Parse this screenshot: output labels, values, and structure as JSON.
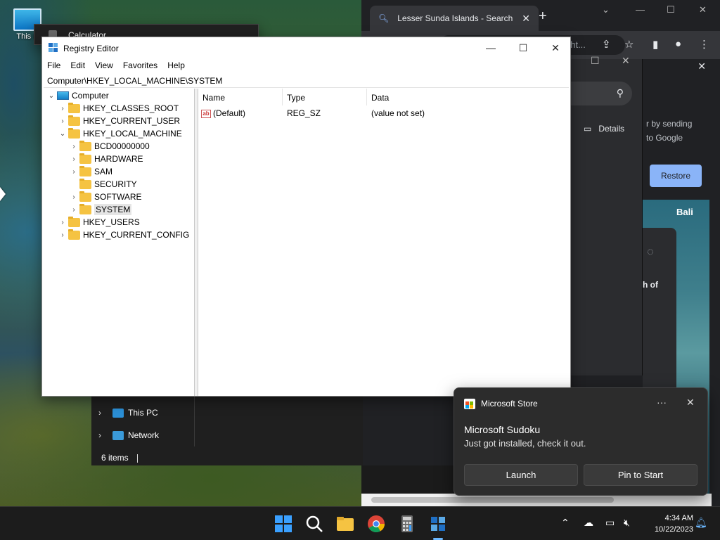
{
  "desktop": {
    "icon_label": "This P"
  },
  "calculator": {
    "title": "Calculator"
  },
  "chrome": {
    "tab_title": "Lesser Sunda Islands - Search",
    "omnibox_text": "ght...",
    "details_label": "Details",
    "partial_text_1": "r by sending",
    "partial_text_2": "to Google",
    "restore_label": "Restore",
    "bali_label": "Bali",
    "card_text": "h of"
  },
  "regedit": {
    "title": "Registry Editor",
    "menu": [
      "File",
      "Edit",
      "View",
      "Favorites",
      "Help"
    ],
    "address": "Computer\\HKEY_LOCAL_MACHINE\\SYSTEM",
    "tree": {
      "root": "Computer",
      "hkcr": "HKEY_CLASSES_ROOT",
      "hkcu": "HKEY_CURRENT_USER",
      "hklm": "HKEY_LOCAL_MACHINE",
      "bcd": "BCD00000000",
      "hardware": "HARDWARE",
      "sam": "SAM",
      "security": "SECURITY",
      "software": "SOFTWARE",
      "system": "SYSTEM",
      "hku": "HKEY_USERS",
      "hkcc": "HKEY_CURRENT_CONFIG"
    },
    "columns": {
      "name": "Name",
      "type": "Type",
      "data": "Data"
    },
    "values": [
      {
        "name": "(Default)",
        "type": "REG_SZ",
        "data": "(value not set)"
      }
    ]
  },
  "explorer": {
    "this_pc": "This PC",
    "network": "Network",
    "status": "6 items"
  },
  "notification": {
    "app": "Microsoft Store",
    "heading": "Microsoft Sudoku",
    "body": "Just got installed, check it out.",
    "launch_label": "Launch",
    "pin_label": "Pin to Start"
  },
  "taskbar": {
    "time": "4:34 AM",
    "date": "10/22/2023"
  },
  "colors": {
    "accent": "#8ab4f8",
    "taskbar_bg": "#1c1c1c",
    "toast_bg": "#2c2c2c",
    "folder": "#f5c342"
  }
}
